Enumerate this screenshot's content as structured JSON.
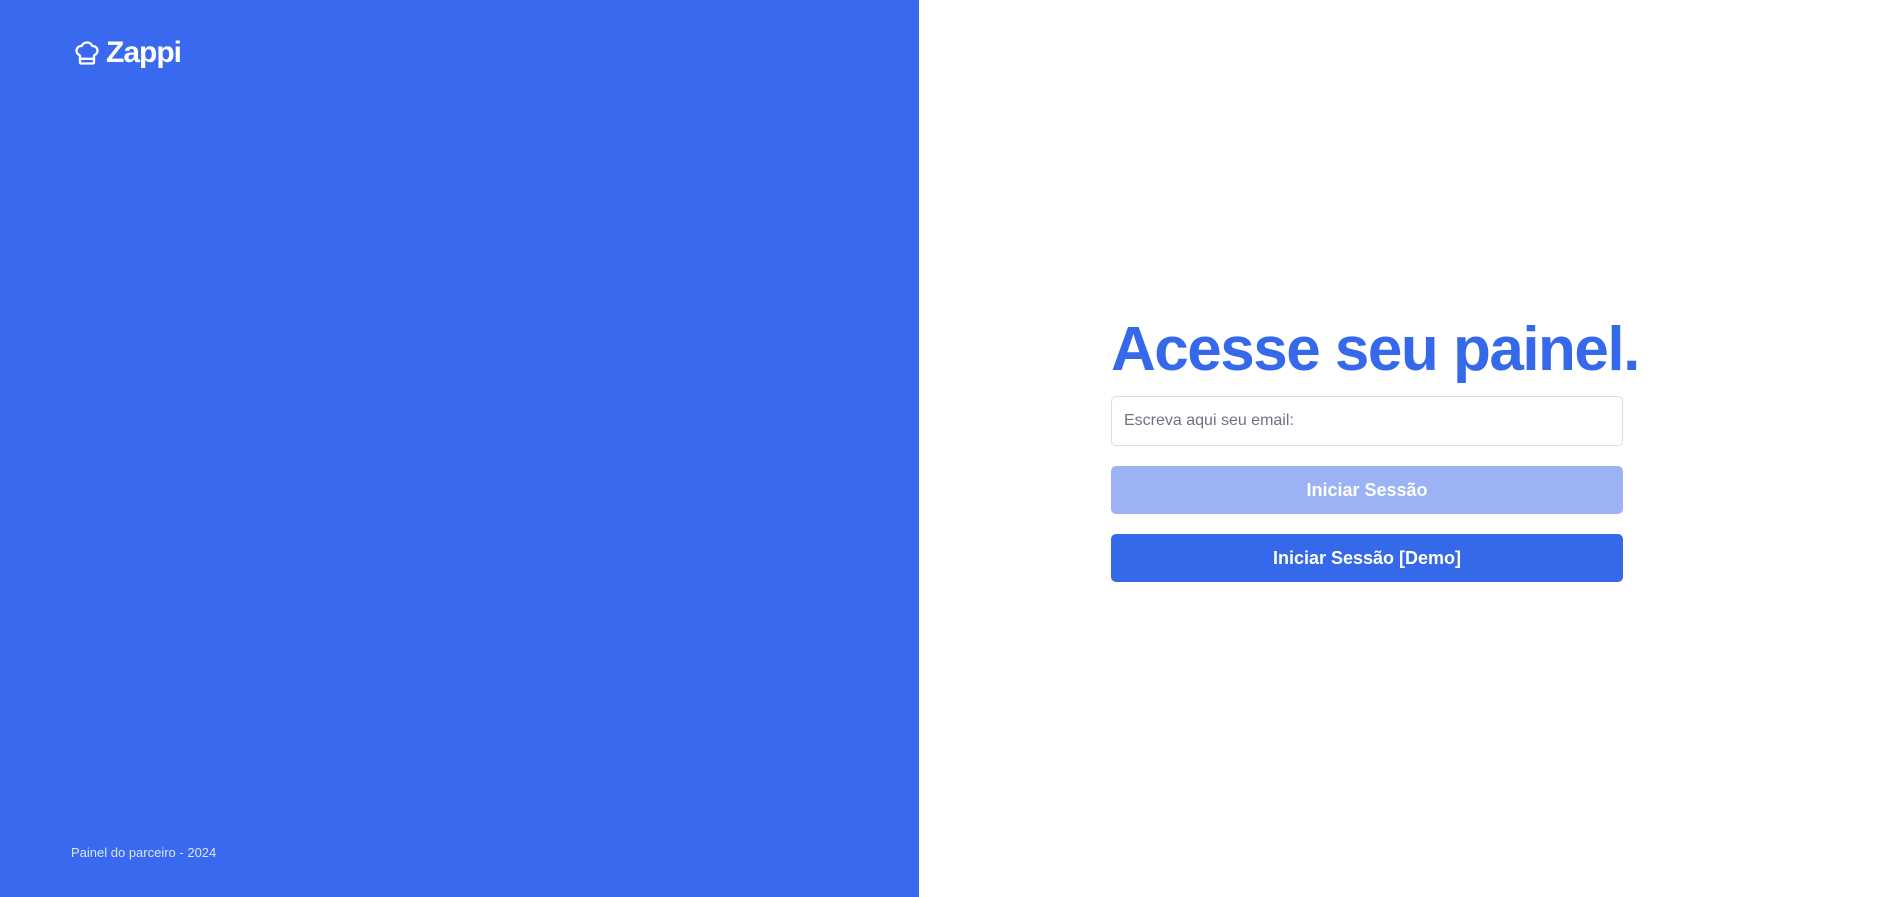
{
  "brand": {
    "name": "Zappi",
    "icon": "chef-hat-icon",
    "footer": "Painel do parceiro - 2024"
  },
  "login": {
    "title": "Acesse seu painel.",
    "email_placeholder": "Escreva aqui seu email:",
    "email_value": "",
    "login_button": "Iniciar Sessão",
    "demo_button": "Iniciar Sessão [Demo]"
  },
  "colors": {
    "brand_blue": "#3869ee",
    "accent": "#3569ea",
    "button_disabled": "#9bb3f4",
    "background": "#ffffff"
  }
}
